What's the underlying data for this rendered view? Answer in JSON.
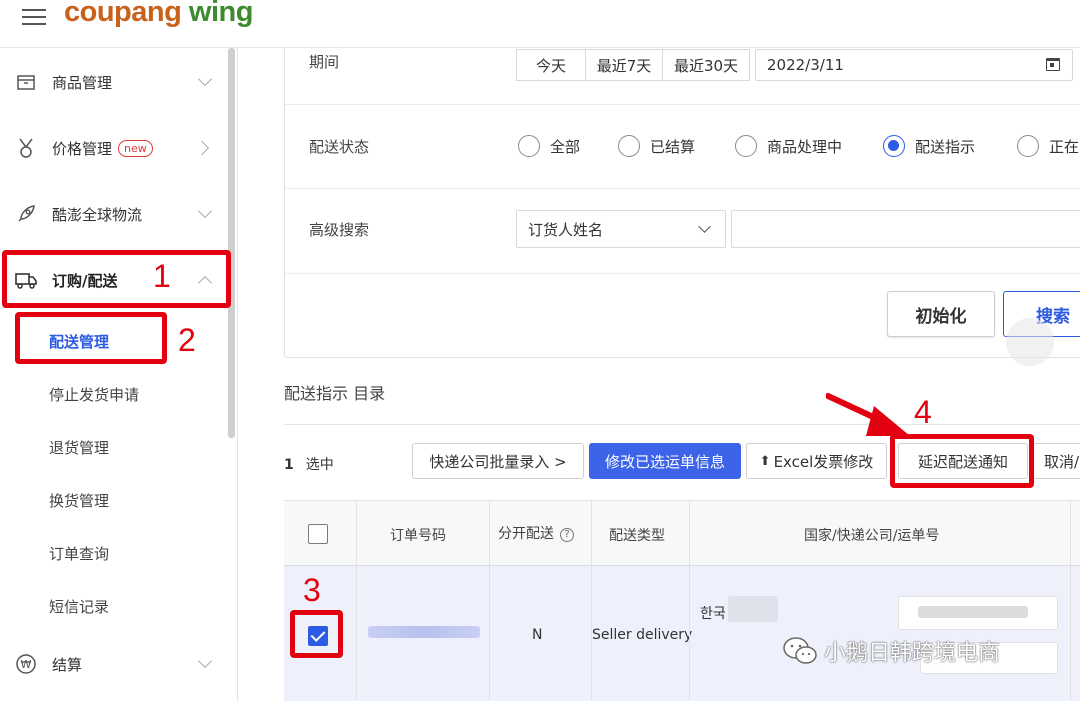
{
  "header": {
    "logo_part1": "coupang",
    "logo_part2": "wing"
  },
  "sidebar": {
    "items": [
      {
        "label": "商品管理",
        "icon": "box-icon"
      },
      {
        "label": "价格管理",
        "badge": "new",
        "icon": "medal-icon"
      },
      {
        "label": "酷澎全球物流",
        "icon": "rocket-icon"
      },
      {
        "label": "订购/配送",
        "icon": "truck-icon"
      },
      {
        "label": "结算",
        "icon": "won-coin-icon"
      }
    ],
    "subitems": [
      "配送管理",
      "停止发货申请",
      "退货管理",
      "换货管理",
      "订单查询",
      "短信记录"
    ]
  },
  "filters": {
    "period_label": "期间",
    "period_buttons": [
      "今天",
      "最近7天",
      "最近30天"
    ],
    "date_value": "2022/3/11",
    "status_label": "配送状态",
    "status_options": [
      "全部",
      "已结算",
      "商品处理中",
      "配送指示",
      "正在"
    ],
    "status_selected": "配送指示",
    "advanced_label": "高级搜索",
    "advanced_select": "订货人姓名",
    "reset_button": "初始化",
    "search_button": "搜索"
  },
  "list": {
    "title": "配送指示 目录",
    "selected_count": "1",
    "selected_label": "选中",
    "actions": [
      "快递公司批量录入 >",
      "修改已选运单信息",
      "Excel发票修改",
      "延迟配送通知",
      "取消/"
    ],
    "columns": [
      "订单号码",
      "分开配送",
      "配送类型",
      "国家/快递公司/运单号"
    ],
    "help_icon_text": "?",
    "row": {
      "checked": true,
      "split_delivery": "N",
      "delivery_type": "Seller delivery",
      "country": "한국"
    }
  },
  "annotations": [
    "1",
    "2",
    "3",
    "4"
  ],
  "watermark": "小鹅日韩跨境电商",
  "colors": {
    "accent": "#2d5be3",
    "annotation": "#e30010",
    "logo_coupang": "#c8621a",
    "logo_wing": "#3d8b2f"
  }
}
